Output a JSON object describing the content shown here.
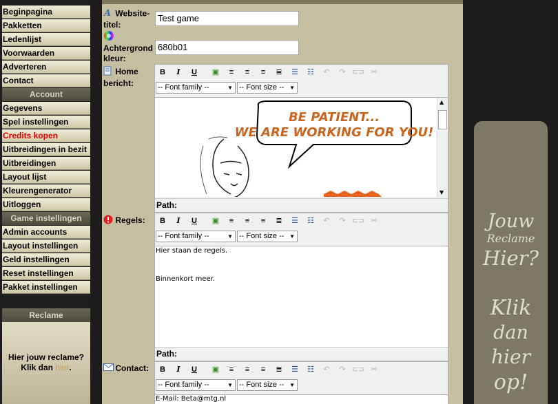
{
  "sidebar": {
    "top_items": [
      "Beginpagina",
      "Pakketten",
      "Ledenlijst",
      "Voorwaarden",
      "Adverteren",
      "Contact"
    ],
    "account_heading": "Account",
    "account_items": [
      "Gegevens",
      "Spel instellingen",
      "Credits kopen",
      "Uitbreidingen in bezit",
      "Uitbreidingen",
      "Layout lijst",
      "Kleurengenerator",
      "Uitloggen"
    ],
    "game_heading": "Game instellingen",
    "game_items": [
      "Admin accounts",
      "Layout instellingen",
      "Geld instellingen",
      "Reset instellingen",
      "Pakket instellingen"
    ],
    "reclame_heading": "Reclame",
    "reclame_text": "Hier jouw reclame?",
    "reclame_klik": "Klik dan",
    "reclame_link": "hier",
    "reclame_dot": "."
  },
  "form": {
    "website_title_label_1": "Website-",
    "website_title_label_2": "titel:",
    "website_title_value": "Test game",
    "bg_label_1": "Achtergrond",
    "bg_label_2": "kleur:",
    "bg_value": "680b01",
    "home_label_1": "Home",
    "home_label_2": "bericht:",
    "rules_label": "Regels:",
    "contact_label": "Contact:",
    "font_family": "-- Font family --",
    "font_size": "-- Font size --",
    "path_label": "Path:",
    "home_banner_1": "BE PATIENT...",
    "home_banner_2": "WE ARE WORKING FOR YOU!",
    "rules_line_1": "Hier staan de regels.",
    "rules_line_2": "Binnenkort meer.",
    "contact_line_1": "E-Mail: Beta@mtg.nl"
  },
  "right_ad": {
    "line1": "Jouw",
    "line2": "Reclame",
    "line3": "Hier?",
    "line4": "Klik",
    "line5": "dan",
    "line6": "hier",
    "line7": "op!"
  },
  "colors": {
    "accent_red": "#e00000",
    "panel": "#c5bea0",
    "comic_orange": "#c8651e"
  }
}
